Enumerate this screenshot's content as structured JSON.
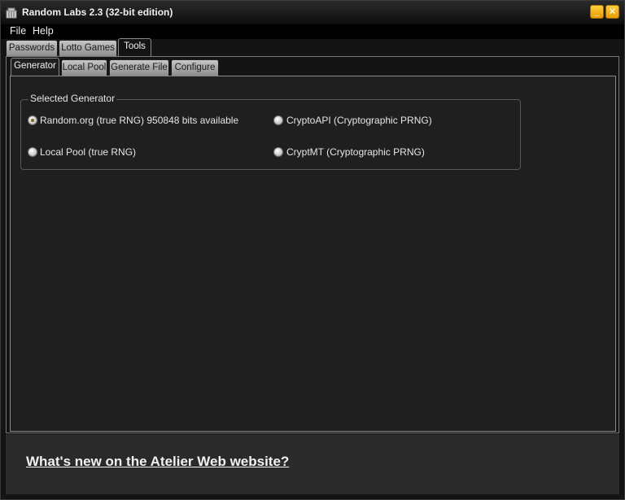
{
  "window": {
    "title": "Random Labs 2.3 (32-bit edition)",
    "minimize_glyph": "_",
    "close_glyph": "✕",
    "icon": "app-icon"
  },
  "menu": {
    "items": [
      "File",
      "Help"
    ]
  },
  "main_tabs": [
    "Passwords",
    "Lotto Games",
    "Tools"
  ],
  "main_tab_active": "Tools",
  "tools_tabs": [
    "Generator",
    "Local Pool",
    "Generate File",
    "Configure"
  ],
  "tools_tab_active": "Generator",
  "generator": {
    "group_label": "Selected Generator",
    "options": [
      {
        "label": "Random.org (true RNG) 950848 bits available",
        "checked": true
      },
      {
        "label": "CryptoAPI (Cryptographic PRNG)",
        "checked": false
      },
      {
        "label": "Local Pool (true RNG)",
        "checked": false
      },
      {
        "label": "CryptMT  (Cryptographic PRNG)",
        "checked": false
      }
    ]
  },
  "footer": {
    "link": "What's new on the Atelier Web website?"
  },
  "colors": {
    "accent": "#f0a800",
    "background": "#1f1f1f"
  }
}
